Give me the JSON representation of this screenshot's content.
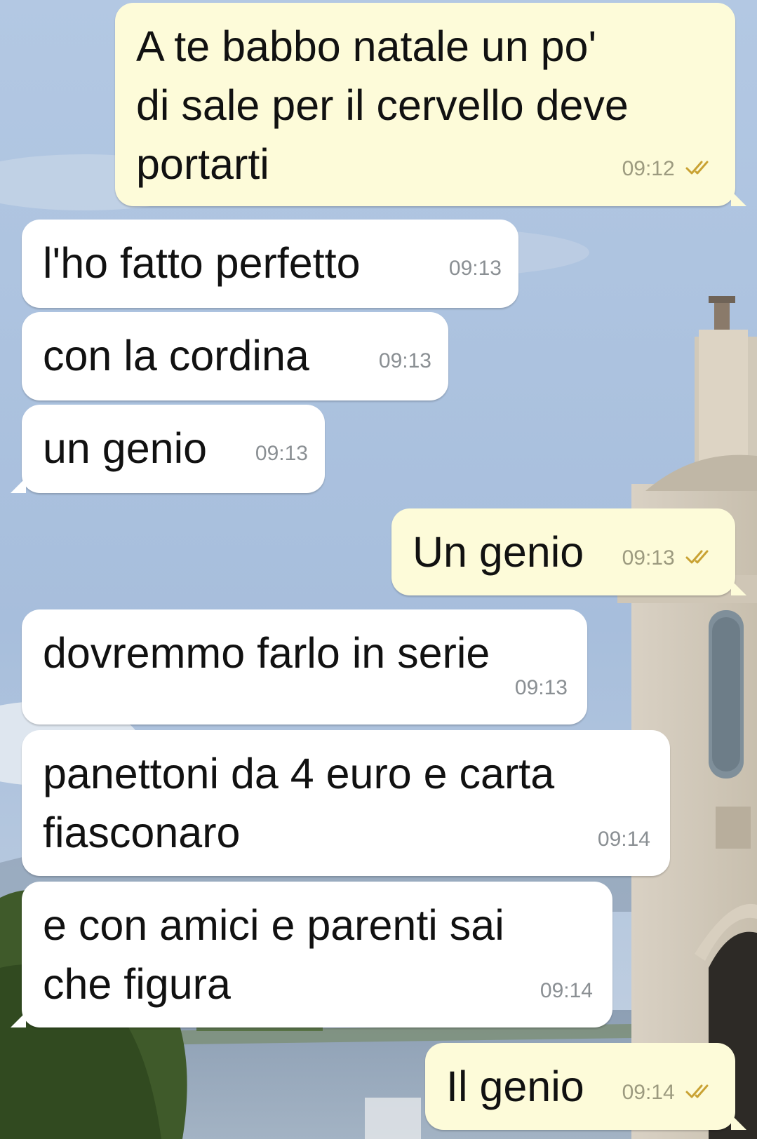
{
  "chat": {
    "messages": [
      {
        "direction": "out",
        "text": "A te babbo natale un po'\ndi sale per il cervello deve\nportarti",
        "time": "09:12",
        "status_icon": "double-check-icon"
      },
      {
        "direction": "in",
        "text": "l'ho fatto perfetto",
        "time": "09:13"
      },
      {
        "direction": "in",
        "text": "con la cordina",
        "time": "09:13"
      },
      {
        "direction": "in",
        "text": "un genio",
        "time": "09:13"
      },
      {
        "direction": "out",
        "text": "Un genio",
        "time": "09:13",
        "status_icon": "double-check-icon"
      },
      {
        "direction": "in",
        "text": "dovremmo farlo in serie",
        "time": "09:13"
      },
      {
        "direction": "in",
        "text": "panettoni da 4 euro e carta\nfiasconaro",
        "time": "09:14"
      },
      {
        "direction": "in",
        "text": "e con amici e parenti sai\nche figura",
        "time": "09:14"
      },
      {
        "direction": "out",
        "text": "Il genio",
        "time": "09:14",
        "status_icon": "double-check-icon"
      }
    ]
  },
  "colors": {
    "outgoing_bubble": "#fdfbd9",
    "incoming_bubble": "#ffffff",
    "read_ticks": "#c9a233",
    "sky": "#a9c0dc"
  },
  "wallpaper": {
    "description_icon": "wallpaper-photo"
  }
}
